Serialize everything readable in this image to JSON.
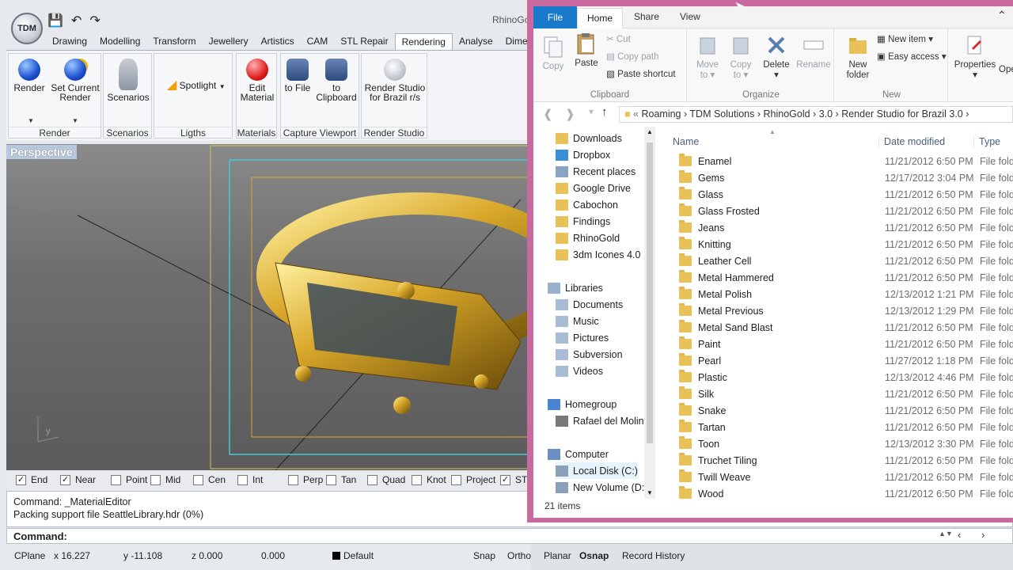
{
  "rhino": {
    "logo": "TDM",
    "app_title": "RhinoGo",
    "tabs": [
      "Drawing",
      "Modelling",
      "Transform",
      "Jewellery",
      "Artistics",
      "CAM",
      "STL Repair",
      "Rendering",
      "Analyse",
      "Dimens"
    ],
    "active_tab": "Rendering",
    "groups": {
      "render": {
        "label": "Render",
        "btn1": "Render",
        "btn2a": "Set Current",
        "btn2b": "Render"
      },
      "scenarios": {
        "label": "Scenarios",
        "btn": "Scenarios"
      },
      "lights": {
        "label": "Ligths",
        "btn": "Spotlight"
      },
      "materials": {
        "label": "Materials",
        "btn_a": "Edit",
        "btn_b": "Material"
      },
      "capture": {
        "label": "Capture Viewport",
        "btn1": "to File",
        "btn2a": "to",
        "btn2b": "Clipboard"
      },
      "studio": {
        "label": "Render Studio",
        "btn_a": "Render Studio",
        "btn_b": "for Brazil r/s"
      }
    },
    "viewport_label": "Perspective",
    "axis_labels": {
      "y": "y",
      "x": "x"
    },
    "osnap": [
      {
        "label": "End",
        "checked": true
      },
      {
        "label": "Near",
        "checked": true
      },
      {
        "label": "Point",
        "checked": false
      },
      {
        "label": "Mid",
        "checked": false
      },
      {
        "label": "Cen",
        "checked": false
      },
      {
        "label": "Int",
        "checked": false
      },
      {
        "label": "Perp",
        "checked": false
      },
      {
        "label": "Tan",
        "checked": false
      },
      {
        "label": "Quad",
        "checked": false
      },
      {
        "label": "Knot",
        "checked": false
      },
      {
        "label": "Project",
        "checked": false
      },
      {
        "label": "STr",
        "checked": true
      }
    ],
    "command_history": [
      "Command: _MaterialEditor",
      "Packing support file SeattleLibrary.hdr (0%)"
    ],
    "command_prompt": "Command:",
    "status": {
      "cplane": "CPlane",
      "x": "x 16.227",
      "y": "y -11.108",
      "z": "z 0.000",
      "val": "0.000",
      "layer": "Default",
      "snap": "Snap",
      "ortho": "Ortho",
      "planar": "Planar",
      "osnap": "Osnap",
      "record": "Record History"
    }
  },
  "explorer": {
    "tabs": {
      "file": "File",
      "home": "Home",
      "share": "Share",
      "view": "View"
    },
    "clipboard": {
      "label": "Clipboard",
      "copy": "Copy",
      "paste": "Paste",
      "cut": "Cut",
      "copy_path": "Copy path",
      "paste_shortcut": "Paste shortcut"
    },
    "organize": {
      "label": "Organize",
      "move_a": "Move",
      "move_b": "to",
      "copy_a": "Copy",
      "copy_b": "to",
      "delete": "Delete",
      "rename": "Rename"
    },
    "new": {
      "label": "New",
      "new_folder_a": "New",
      "new_folder_b": "folder",
      "new_item": "New item",
      "easy_access": "Easy access"
    },
    "open": {
      "properties": "Properties",
      "open": "Oper"
    },
    "address": [
      "Roaming",
      "TDM Solutions",
      "RhinoGold",
      "3.0",
      "Render Studio for Brazil 3.0"
    ],
    "nav": [
      {
        "label": "Downloads",
        "icon": "downloads-icon",
        "color": "#e8c258"
      },
      {
        "label": "Dropbox",
        "icon": "dropbox-icon",
        "color": "#3a8fd6"
      },
      {
        "label": "Recent places",
        "icon": "recent-places-icon",
        "color": "#8aa4c4"
      },
      {
        "label": "Google Drive",
        "icon": "folder-icon",
        "color": "#e8c258"
      },
      {
        "label": "Cabochon",
        "icon": "folder-icon",
        "color": "#e8c258"
      },
      {
        "label": "Findings",
        "icon": "folder-icon",
        "color": "#e8c258"
      },
      {
        "label": "RhinoGold",
        "icon": "folder-icon",
        "color": "#e8c258"
      },
      {
        "label": "3dm Icones 4.0",
        "icon": "folder-icon",
        "color": "#e8c258"
      }
    ],
    "libraries": {
      "label": "Libraries",
      "items": [
        "Documents",
        "Music",
        "Pictures",
        "Subversion",
        "Videos"
      ]
    },
    "homegroup": {
      "label": "Homegroup",
      "user": "Rafael del Molinc"
    },
    "computer": {
      "label": "Computer",
      "drives": [
        "Local Disk (C:)",
        "New Volume (D:)"
      ]
    },
    "columns": {
      "name": "Name",
      "date": "Date modified",
      "type": "Type"
    },
    "files": [
      {
        "name": "Enamel",
        "date": "11/21/2012 6:50 PM",
        "type": "File folde"
      },
      {
        "name": "Gems",
        "date": "12/17/2012 3:04 PM",
        "type": "File folde"
      },
      {
        "name": "Glass",
        "date": "11/21/2012 6:50 PM",
        "type": "File folde"
      },
      {
        "name": "Glass Frosted",
        "date": "11/21/2012 6:50 PM",
        "type": "File folde"
      },
      {
        "name": "Jeans",
        "date": "11/21/2012 6:50 PM",
        "type": "File folde"
      },
      {
        "name": "Knitting",
        "date": "11/21/2012 6:50 PM",
        "type": "File folde"
      },
      {
        "name": "Leather Cell",
        "date": "11/21/2012 6:50 PM",
        "type": "File folde"
      },
      {
        "name": "Metal Hammered",
        "date": "11/21/2012 6:50 PM",
        "type": "File folde"
      },
      {
        "name": "Metal Polish",
        "date": "12/13/2012 1:21 PM",
        "type": "File folde"
      },
      {
        "name": "Metal Previous",
        "date": "12/13/2012 1:29 PM",
        "type": "File folde"
      },
      {
        "name": "Metal Sand Blast",
        "date": "11/21/2012 6:50 PM",
        "type": "File folde"
      },
      {
        "name": "Paint",
        "date": "11/21/2012 6:50 PM",
        "type": "File folde"
      },
      {
        "name": "Pearl",
        "date": "11/27/2012 1:18 PM",
        "type": "File folde"
      },
      {
        "name": "Plastic",
        "date": "12/13/2012 4:46 PM",
        "type": "File folde"
      },
      {
        "name": "Silk",
        "date": "11/21/2012 6:50 PM",
        "type": "File folde"
      },
      {
        "name": "Snake",
        "date": "11/21/2012 6:50 PM",
        "type": "File folde"
      },
      {
        "name": "Tartan",
        "date": "11/21/2012 6:50 PM",
        "type": "File folde"
      },
      {
        "name": "Toon",
        "date": "12/13/2012 3:30 PM",
        "type": "File folde"
      },
      {
        "name": "Truchet Tiling",
        "date": "11/21/2012 6:50 PM",
        "type": "File folde"
      },
      {
        "name": "Twill Weave",
        "date": "11/21/2012 6:50 PM",
        "type": "File folde"
      },
      {
        "name": "Wood",
        "date": "11/21/2012 6:50 PM",
        "type": "File folde"
      }
    ],
    "item_count": "21 items",
    "accent": "#1979ca",
    "frame_color": "#c869a0"
  }
}
